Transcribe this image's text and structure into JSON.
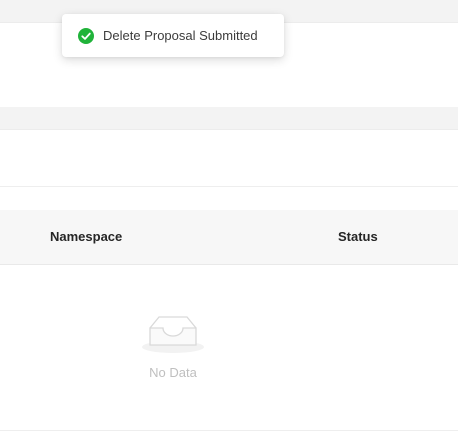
{
  "toast": {
    "message": "Delete Proposal Submitted",
    "icon": "check-circle-icon",
    "color": "#20b33a"
  },
  "table": {
    "columns": [
      "Namespace",
      "Status"
    ],
    "empty_text": "No Data",
    "empty_icon": "empty-inbox-icon"
  }
}
